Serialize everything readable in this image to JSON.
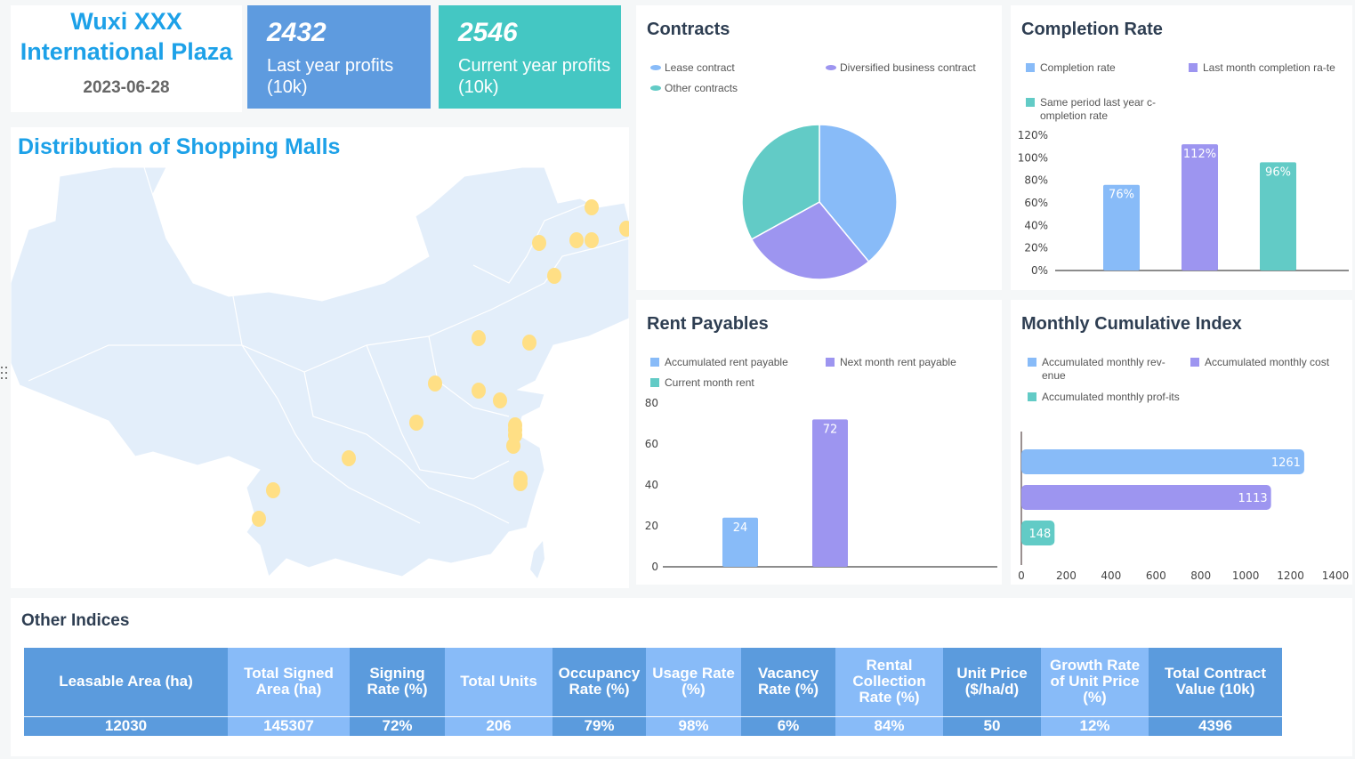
{
  "header": {
    "title_line1": "Wuxi XXX",
    "title_line2": "International Plaza",
    "date": "2023-06-28",
    "kpis": [
      {
        "value": "2432",
        "label": "Last year profits (10k)",
        "color": "#5e9bdf"
      },
      {
        "value": "2546",
        "label": "Current year profits (10k)",
        "color": "#44c7c3"
      }
    ]
  },
  "map": {
    "title": "Distribution of Shopping Malls",
    "marker_color": "#ffdf85",
    "region_color": "#e3eefa"
  },
  "colors": {
    "blue": "#88bbf8",
    "purple": "#9d95f0",
    "teal": "#62cbc6",
    "title": "#2e3e52"
  },
  "chart_data": [
    {
      "type": "pie",
      "title": "Contracts",
      "legend": [
        "Lease contract",
        "Diversified business contract",
        "Other contracts"
      ],
      "categories": [
        "Lease contract",
        "Diversified business contract",
        "Other contracts"
      ],
      "values": [
        39,
        28,
        33
      ],
      "legend_position": "top"
    },
    {
      "type": "bar",
      "title": "Completion Rate",
      "legend": [
        "Completion rate",
        "Last month completion ra-te",
        "Same period last year c-ompletion rate"
      ],
      "categories": [
        "Completion rate",
        "Last month completion rate",
        "Same period last year completion rate"
      ],
      "values": [
        76,
        112,
        96
      ],
      "data_labels": [
        "76%",
        "112%",
        "96%"
      ],
      "yticks": [
        "0%",
        "20%",
        "40%",
        "60%",
        "80%",
        "100%",
        "120%"
      ],
      "ylim": [
        0,
        120
      ],
      "legend_position": "top"
    },
    {
      "type": "bar",
      "title": "Rent Payables",
      "legend": [
        "Accumulated rent payable",
        "Next month rent payable",
        "Current month rent"
      ],
      "categories": [
        "Accumulated rent payable",
        "Next month rent payable",
        "Current month rent"
      ],
      "values": [
        24,
        72,
        0
      ],
      "data_labels": [
        "24",
        "72",
        ""
      ],
      "yticks": [
        "0",
        "20",
        "40",
        "60",
        "80"
      ],
      "ylim": [
        0,
        80
      ],
      "legend_position": "top"
    },
    {
      "type": "bar",
      "orientation": "horizontal",
      "title": "Monthly Cumulative Index",
      "legend": [
        "Accumulated monthly rev-enue",
        "Accumulated monthly cost",
        "Accumulated monthly prof-its"
      ],
      "categories": [
        "Accumulated monthly revenue",
        "Accumulated monthly cost",
        "Accumulated monthly profits"
      ],
      "values": [
        1261,
        1113,
        148
      ],
      "data_labels": [
        "1261",
        "1113",
        "148"
      ],
      "xticks": [
        "0",
        "200",
        "400",
        "600",
        "800",
        "1000",
        "1200",
        "1400"
      ],
      "xlim": [
        0,
        1400
      ],
      "legend_position": "top"
    }
  ],
  "indices": {
    "title": "Other Indices",
    "columns": [
      {
        "header": "Leasable Area (ha)",
        "value": "12030"
      },
      {
        "header": "Total Signed Area (ha)",
        "value": "145307"
      },
      {
        "header": "Signing Rate (%)",
        "value": "72%"
      },
      {
        "header": "Total Units",
        "value": "206"
      },
      {
        "header": "Occupancy Rate (%)",
        "value": "79%"
      },
      {
        "header": "Usage Rate (%)",
        "value": "98%"
      },
      {
        "header": "Vacancy Rate (%)",
        "value": "6%"
      },
      {
        "header": "Rental Collection Rate (%)",
        "value": "84%"
      },
      {
        "header": "Unit Price ($/ha/d)",
        "value": "50"
      },
      {
        "header": "Growth Rate of Unit Price (%)",
        "value": "12%"
      },
      {
        "header": "Total Contract Value (10k)",
        "value": "4396"
      }
    ]
  }
}
